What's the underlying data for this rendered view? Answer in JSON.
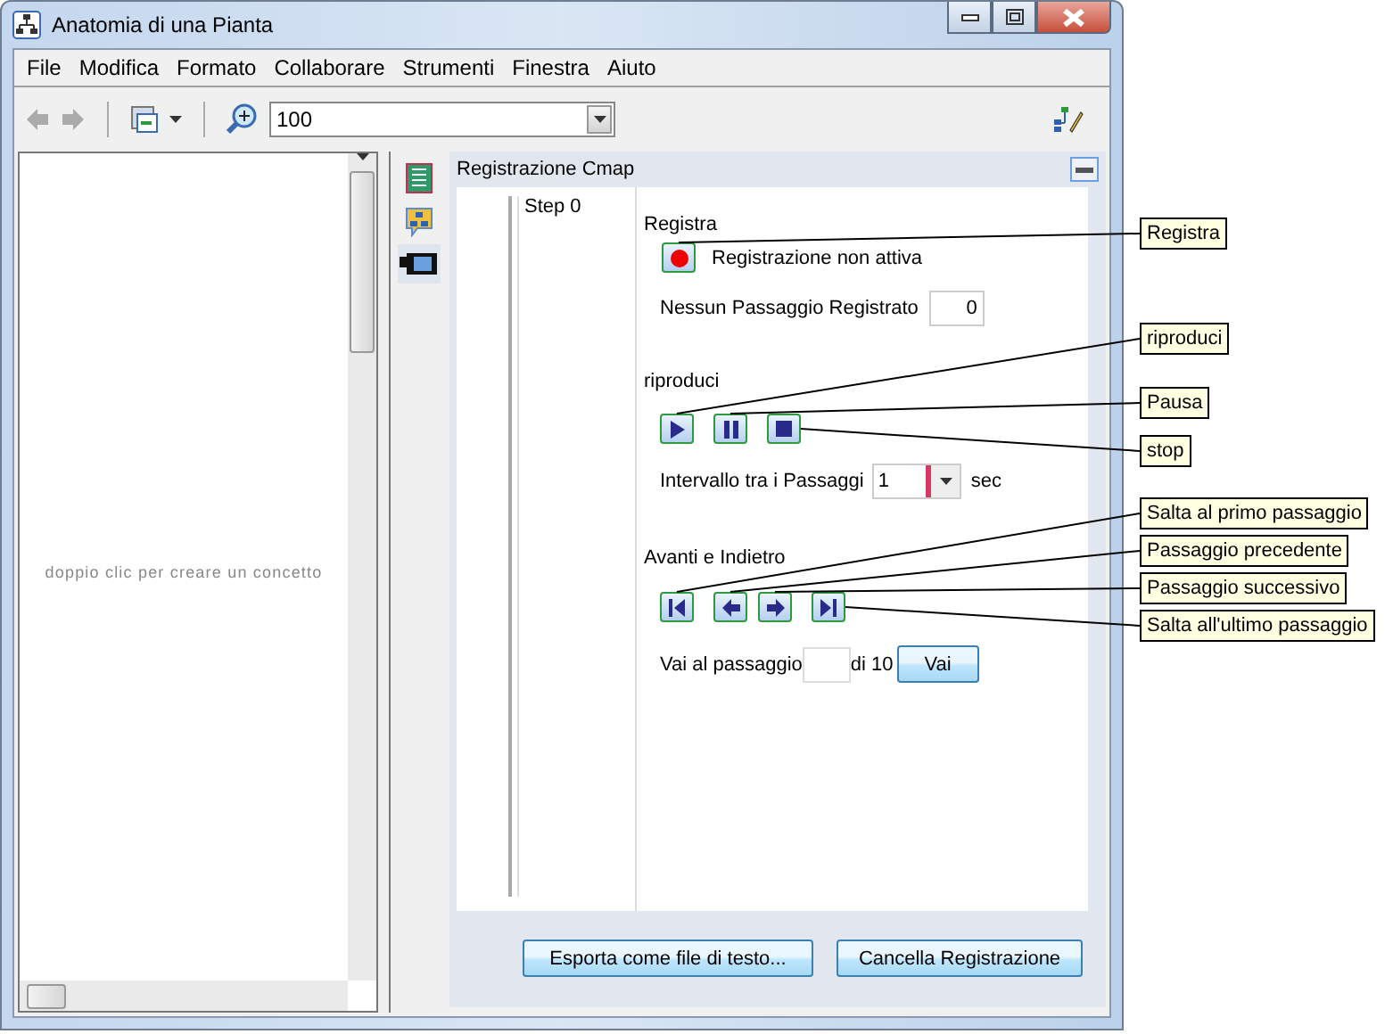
{
  "window": {
    "title": "Anatomia di una Pianta"
  },
  "menu": [
    "File",
    "Modifica",
    "Formato",
    "Collaborare",
    "Strumenti",
    "Finestra",
    "Aiuto"
  ],
  "toolbar": {
    "zoom": "100"
  },
  "canvas": {
    "hint": "doppio clic per creare un concetto"
  },
  "side_tabs": [
    {
      "kind": "list",
      "selected": false
    },
    {
      "kind": "map",
      "selected": false
    },
    {
      "kind": "camera",
      "selected": true
    }
  ],
  "panel": {
    "title": "Registrazione Cmap",
    "steps": [
      "Step 0"
    ],
    "record": {
      "heading": "Registra",
      "status": "Registrazione non attiva",
      "count_label": "Nessun Passaggio Registrato",
      "count": "0"
    },
    "play": {
      "heading": "riproduci",
      "interval_label": "Intervallo tra i Passaggi",
      "interval": "1",
      "unit": "sec"
    },
    "navigate": {
      "heading": "Avanti e Indietro",
      "goto_label": "Vai al passaggio",
      "goto_total": "di 10",
      "goto_button": "Vai"
    },
    "buttons": [
      "Esporta come file di testo...",
      "Cancella Registrazione"
    ]
  },
  "callouts": [
    "Registra",
    "riproduci",
    "Pausa",
    "stop",
    "Salta al primo passaggio",
    "Passaggio precedente",
    "Passaggio successivo",
    "Salta all'ultimo passaggio"
  ]
}
